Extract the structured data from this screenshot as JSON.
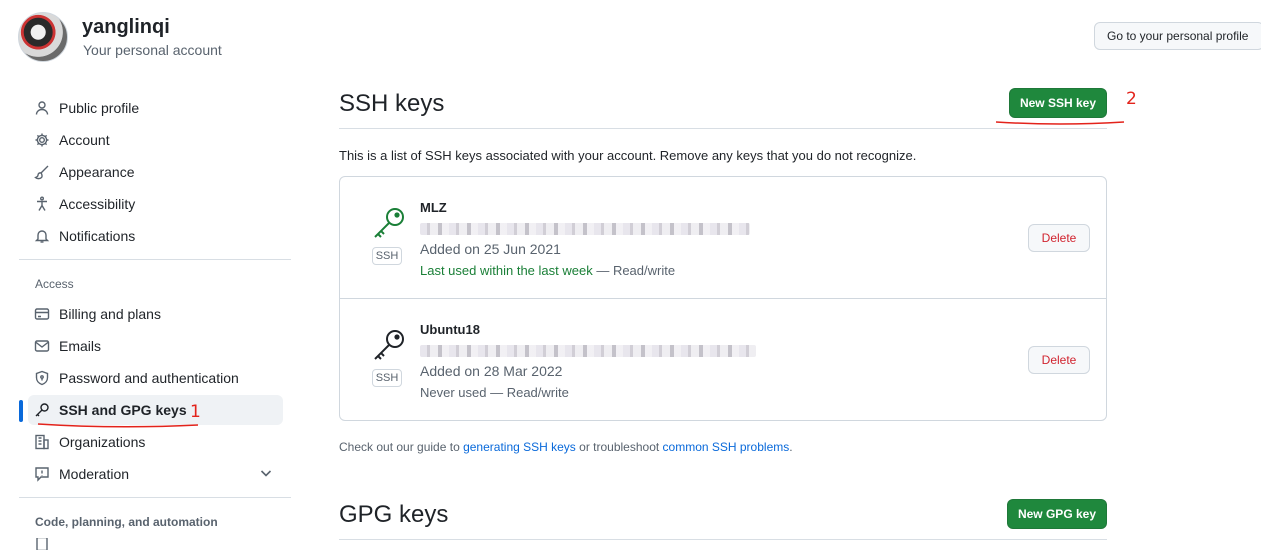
{
  "header": {
    "username": "yanglinqi",
    "account_type": "Your personal account",
    "profile_button": "Go to your personal profile"
  },
  "sidebar": {
    "items": [
      {
        "label": "Public profile",
        "icon": "person-icon"
      },
      {
        "label": "Account",
        "icon": "gear-icon"
      },
      {
        "label": "Appearance",
        "icon": "paintbrush-icon"
      },
      {
        "label": "Accessibility",
        "icon": "accessibility-icon"
      },
      {
        "label": "Notifications",
        "icon": "bell-icon"
      }
    ],
    "access_heading": "Access",
    "access_items": [
      {
        "label": "Billing and plans",
        "icon": "credit-card-icon"
      },
      {
        "label": "Emails",
        "icon": "mail-icon"
      },
      {
        "label": "Password and authentication",
        "icon": "shield-lock-icon"
      },
      {
        "label": "SSH and GPG keys",
        "icon": "key-icon",
        "active": true
      },
      {
        "label": "Organizations",
        "icon": "organization-icon"
      },
      {
        "label": "Moderation",
        "icon": "report-icon"
      }
    ],
    "code_heading": "Code, planning, and automation"
  },
  "annotations": {
    "one": "1",
    "two": "2",
    "accent_color": "#e3231b"
  },
  "ssh": {
    "title": "SSH keys",
    "new_button": "New SSH key",
    "intro": "This is a list of SSH keys associated with your account. Remove any keys that you do not recognize.",
    "keys": [
      {
        "name": "MLZ",
        "badge": "SSH",
        "added": "Added on 25 Jun 2021",
        "used_prefix": "Last used within the last week",
        "used_suffix": " — Read/write",
        "delete": "Delete",
        "icon_color": "#1a7f37"
      },
      {
        "name": "Ubuntu18",
        "badge": "SSH",
        "added": "Added on 28 Mar 2022",
        "used_prefix": "Never used",
        "used_suffix": " — Read/write",
        "delete": "Delete",
        "icon_color": "#1f2328"
      }
    ],
    "guide_prefix": "Check out our guide to ",
    "guide_link1": "generating SSH keys",
    "guide_mid": " or troubleshoot ",
    "guide_link2": "common SSH problems",
    "guide_suffix": "."
  },
  "gpg": {
    "title": "GPG keys",
    "new_button": "New GPG key"
  },
  "colors": {
    "primary_button": "#1f883d",
    "link": "#0969da",
    "danger": "#d1242f",
    "active_bar": "#0969da"
  }
}
